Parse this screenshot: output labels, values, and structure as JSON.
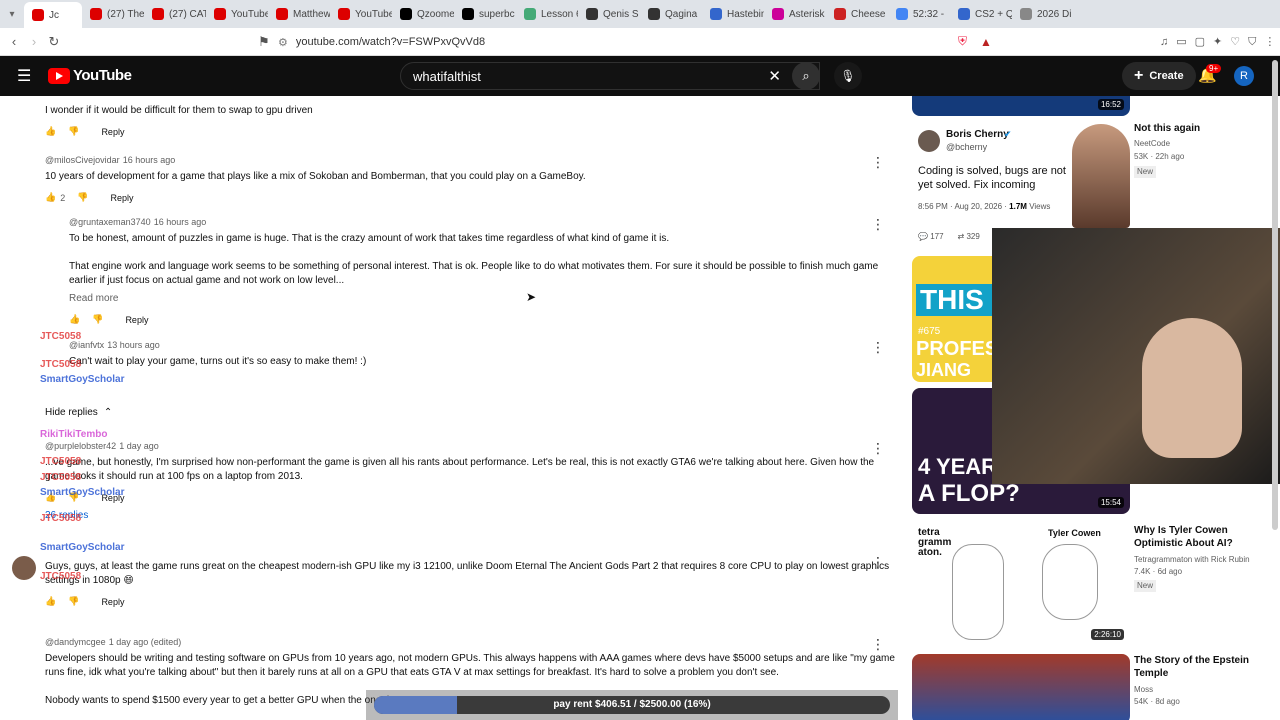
{
  "tabs": [
    {
      "label": "Jc",
      "color": "#d00"
    },
    {
      "label": "(27) The",
      "color": "#d00"
    },
    {
      "label": "(27) CAT",
      "color": "#d00"
    },
    {
      "label": "YouTube",
      "color": "#d00"
    },
    {
      "label": "Matthew",
      "color": "#d00"
    },
    {
      "label": "YouTube",
      "color": "#d00"
    },
    {
      "label": "Qzoome",
      "color": "#000"
    },
    {
      "label": "superbc",
      "color": "#000"
    },
    {
      "label": "Lesson 6",
      "color": "#4a7"
    },
    {
      "label": "Qenis S",
      "color": "#333"
    },
    {
      "label": "Qagina",
      "color": "#333"
    },
    {
      "label": "Hastebin",
      "color": "#36c"
    },
    {
      "label": "Asterisk",
      "color": "#c09"
    },
    {
      "label": "Cheese",
      "color": "#c22"
    },
    {
      "label": "52:32 -",
      "color": "#4285f4"
    },
    {
      "label": "CS2 + Q",
      "color": "#36c"
    },
    {
      "label": "2026 Di",
      "color": "#888"
    }
  ],
  "address": {
    "url": "youtube.com/watch?v=FSWPxvQvVd8"
  },
  "yt": {
    "logo": "YouTube",
    "search_value": "whatifalthist",
    "create": "Create",
    "notif_count": "9+",
    "avatar": "R"
  },
  "comments": [
    {
      "handle": "",
      "time": "",
      "text": "I wonder if it would be difficult for them to swap to gpu driven",
      "likes": ""
    },
    {
      "handle": "@milosCivejovidar",
      "time": "16 hours ago",
      "text": "10 years of development for a game that plays like a mix of Sokoban and Bomberman, that you could play on a GameBoy.",
      "likes": "2",
      "avatar": "m",
      "avcolor": "#1e8e3e"
    },
    {
      "handle": "@gruntaxeman3740",
      "time": "16 hours ago",
      "text": "To be honest, amount of puzzles in game is huge. That is the crazy amount of work that takes time regardless of what kind of game it is.",
      "text2": "That engine work and language work seems to be something of personal interest. That is ok. People like to do what motivates them. For sure it should be possible to finish much game earlier if just focus on actual game and not work on low level...",
      "readmore": "Read more",
      "avatar": "G",
      "avcolor": "#a142f4"
    },
    {
      "handle": "@ianfvtx",
      "time": "13 hours ago",
      "text": "Can't wait to play your game, turns out it's so easy to make them! :)"
    },
    {
      "handle": "@purplelobster42",
      "time": "1 day ago",
      "text": "...ve game, but honestly, I'm surprised how non-performant the game is given all his rants about performance. Let's be real, this is not exactly GTA6 we're talking about here. Given how the game looks it should run at 100 fps on a laptop from 2013.",
      "replies": "26 replies",
      "avatar": "p",
      "avcolor": "#c00"
    },
    {
      "handle": "",
      "time": "",
      "text": "Guys, guys, at least the game runs great on the cheapest modern-ish GPU like my i3 12100, unlike Doom Eternal The Ancient Gods Part 2 that requires 8 core CPU to play on lowest graphics settings in 1080p 😄"
    },
    {
      "handle": "@dandymcgee",
      "time": "1 day ago (edited)",
      "text": "Developers should be writing and testing software on GPUs from 10 years ago, not modern GPUs. This always happens with AAA games where devs have $5000 setups and are like \"my game runs fine, idk what you're talking about\" but then it barely runs at all on a GPU that eats GTA V at max settings for breakfast. It's hard to solve a problem you don't see.",
      "text2": "Nobody wants to spend $1500 every year to get a better GPU when the one they",
      "avatar": "TheDV",
      "avcolor": "#c22"
    }
  ],
  "reply_label": "Reply",
  "hide_replies": "Hide replies",
  "chat": [
    {
      "name": "JTC5058",
      "color": "#e03030"
    },
    {
      "name": "JTC5058",
      "color": "#e03030"
    },
    {
      "name": "SmartGoyScholar",
      "color": "#2050d0"
    },
    {
      "name": "RikiTikiTembo",
      "color": "#d040d0"
    },
    {
      "name": "JTC5058",
      "color": "#e03030"
    },
    {
      "name": "JTC5058",
      "color": "#e03030"
    },
    {
      "name": "SmartGoyScholar",
      "color": "#2050d0"
    },
    {
      "name": "JTC5058",
      "color": "#e03030"
    },
    {
      "name": "SmartGoyScholar",
      "color": "#2050d0"
    },
    {
      "name": "JTC5058",
      "color": "#e03030"
    }
  ],
  "side": {
    "post": {
      "author": "Boris Cherny",
      "handle": "@bcherny",
      "text": "Coding is solved, bugs are not yet solved. Fix incoming",
      "date": "8:56 PM · Aug 20, 2026",
      "views": "1.7M",
      "views_label": "Views",
      "replies": "177",
      "reposts": "329"
    },
    "v1": {
      "title": "Not this again",
      "channel": "NeetCode",
      "meta": "53K · 22h ago",
      "badge": "New",
      "dur": "16:52"
    },
    "v2": {
      "thumb": "THIS PA",
      "thumb2": "PROFES",
      "thumb3": "JIANG",
      "num": "#675"
    },
    "v3": {
      "thumb": "4 YEARS",
      "thumb2": "A FLOP?",
      "dur": "15:54"
    },
    "v4": {
      "title": "Why Is Tyler Cowen Optimistic About AI?",
      "channel": "Tetragrammaton with Rick Rubin",
      "meta": "7.4K · 6d ago",
      "badge": "New",
      "dur": "2:26:10",
      "thumb": "tetra gramm aton.",
      "thumb2": "Tyler Cowen"
    },
    "v5": {
      "title": "The Story of the Epstein Temple",
      "channel": "Moss",
      "meta": "54K · 8d ago"
    }
  },
  "donation": {
    "text": "pay rent $406.51 / $2500.00 (16%)",
    "progress": 0.16
  }
}
